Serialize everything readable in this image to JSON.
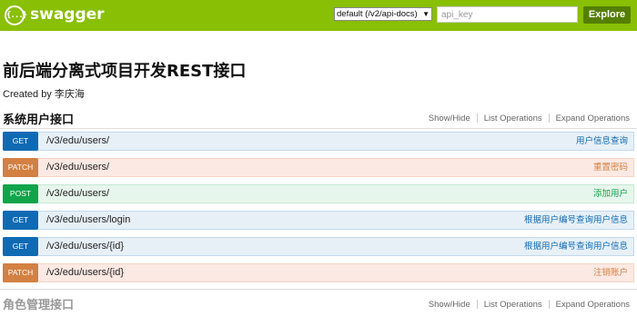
{
  "header": {
    "logo_icon": "{...}",
    "logo_text": "swagger",
    "spec_select": "default (/v2/api-docs)",
    "apikey_placeholder": "api_key",
    "explore_label": "Explore"
  },
  "info": {
    "title": "前后端分离式项目开发REST接口",
    "created_by": "Created by 李庆海"
  },
  "groups": [
    {
      "name": "系统用户接口",
      "links": [
        "Show/Hide",
        "List Operations",
        "Expand Operations"
      ],
      "operations": [
        {
          "method": "GET",
          "path": "/v3/edu/users/",
          "summary": "用户信息查询"
        },
        {
          "method": "PATCH",
          "path": "/v3/edu/users/",
          "summary": "重置密码"
        },
        {
          "method": "POST",
          "path": "/v3/edu/users/",
          "summary": "添加用户"
        },
        {
          "method": "GET",
          "path": "/v3/edu/users/login",
          "summary": "根据用户编号查询用户信息"
        },
        {
          "method": "GET",
          "path": "/v3/edu/users/{id}",
          "summary": "根据用户编号查询用户信息"
        },
        {
          "method": "PATCH",
          "path": "/v3/edu/users/{id}",
          "summary": "注销账户"
        }
      ]
    },
    {
      "name": "角色管理接口",
      "links": [
        "Show/Hide",
        "List Operations",
        "Expand Operations"
      ],
      "operations": []
    }
  ],
  "colors": {
    "header_bg": "#89bf04",
    "get": "#0f6ab4",
    "patch": "#d38042",
    "post": "#10a54a"
  }
}
